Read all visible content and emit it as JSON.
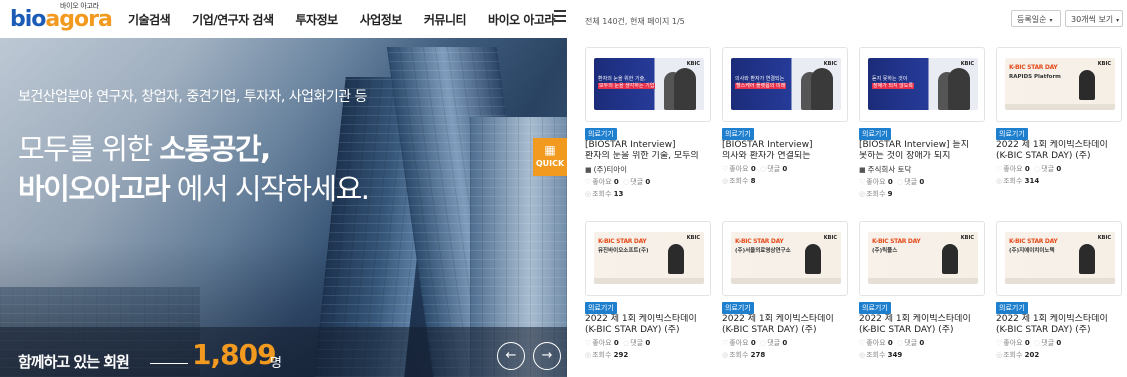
{
  "nav": {
    "logo_tag": "바이오 아고라",
    "logo_word_1": "bio",
    "logo_word_2": "agora",
    "items": [
      "기술검색",
      "기업/연구자 검색",
      "투자정보",
      "사업정보",
      "커뮤니티",
      "바이오 아고라"
    ]
  },
  "hero": {
    "subtitle": "보건산업분야 연구자, 창업자, 중견기업, 투자자, 사업화기관 등",
    "line1_pre": "모두를 위한 ",
    "line1_bold": "소통공간,",
    "line2_bold": "바이오아고라",
    "line2_post": " 에서 시작하세요.",
    "quick_label": "QUICK",
    "members_label": "함께하고 있는 회원",
    "members_count": "1,809",
    "members_unit": "명",
    "prev_arrow": "←",
    "next_arrow": "→"
  },
  "list": {
    "summary": "전체 140건, 현재 페이지 1/5",
    "sort_label": "등록일순",
    "per_page_label": "30개씩 보기",
    "colors": {
      "badge": "#1f7fcf",
      "accent": "#f29a1f",
      "brand_blue": "#1a5bb5"
    },
    "cards": [
      {
        "thumb": "bio",
        "thumb_text": "환자의 눈을 위한 기술,",
        "thumb_text2": "모두의 눈을 생각하는 기업",
        "badge": "의료기기",
        "title1": "[BIOSTAR Interview]",
        "title2": "환자의 눈을 위한 기술, 모두의",
        "org": "(주)티아이",
        "likes": "0",
        "comments": "0",
        "views": "13"
      },
      {
        "thumb": "bio",
        "thumb_text": "의사와 환자가 연결되는",
        "thumb_text2": "헬스케어 플랫폼의 미래",
        "badge": "의료기기",
        "title1": "[BIOSTAR Interview]",
        "title2": "의사와 환자가 연결되는",
        "org": "",
        "likes": "0",
        "comments": "0",
        "views": "8"
      },
      {
        "thumb": "bio",
        "thumb_text": "듣지 못하는 것이",
        "thumb_text2": "장애가 되지 않도록",
        "badge": "의료기기",
        "title1": "[BIOSTAR Interview] 듣지",
        "title2": "못하는 것이 장애가 되지",
        "org": "주식회사 토닥",
        "likes": "0",
        "comments": "0",
        "views": "9"
      },
      {
        "thumb": "kbic",
        "thumb_text": "K-BIC STAR DAY",
        "thumb_text2": "RAPIDS Platform",
        "badge": "의료기기",
        "title1": "2022 제 1회 케이빅스타데이",
        "title2": "(K-BIC STAR DAY) (주)",
        "org": "",
        "likes": "0",
        "comments": "0",
        "views": "314"
      },
      {
        "thumb": "kbic",
        "thumb_text": "K-BIC STAR DAY",
        "thumb_text2": "뮤진바이오소프트(주)",
        "badge": "의료기기",
        "title1": "2022 제 1회 케이빅스타데이",
        "title2": "(K-BIC STAR DAY) (주)",
        "org": "",
        "likes": "0",
        "comments": "0",
        "views": "292"
      },
      {
        "thumb": "kbic",
        "thumb_text": "K-BIC STAR DAY",
        "thumb_text2": "(주)서울의료영상연구소",
        "badge": "의료기기",
        "title1": "2022 제 1회 케이빅스타데이",
        "title2": "(K-BIC STAR DAY) (주)",
        "org": "",
        "likes": "0",
        "comments": "0",
        "views": "278"
      },
      {
        "thumb": "kbic",
        "thumb_text": "K-BIC STAR DAY",
        "thumb_text2": "(주)릭플스",
        "badge": "의료기기",
        "title1": "2022 제 1회 케이빅스타데이",
        "title2": "(K-BIC STAR DAY) (주)",
        "org": "",
        "likes": "0",
        "comments": "0",
        "views": "349"
      },
      {
        "thumb": "kbic",
        "thumb_text": "K-BIC STAR DAY",
        "thumb_text2": "(주)지에이치이노텍",
        "badge": "의료기기",
        "title1": "2022 제 1회 케이빅스타데이",
        "title2": "(K-BIC STAR DAY) (주)",
        "org": "",
        "likes": "0",
        "comments": "0",
        "views": "202"
      }
    ],
    "stat_labels": {
      "likes": "좋아요",
      "comments": "댓글",
      "views": "조회수"
    }
  }
}
